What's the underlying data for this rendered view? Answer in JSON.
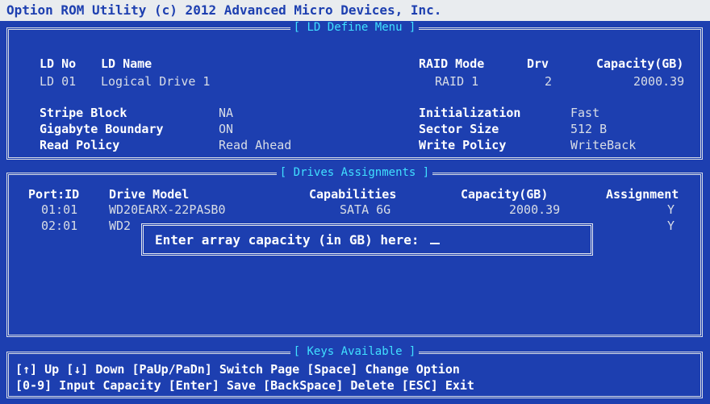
{
  "title": "Option ROM Utility (c) 2012 Advanced Micro Devices, Inc.",
  "ld_panel": {
    "title": "[ LD Define Menu ]",
    "headers": {
      "ld_no": "LD No",
      "ld_name": "LD Name",
      "raid_mode": "RAID Mode",
      "drv": "Drv",
      "capacity": "Capacity(GB)"
    },
    "row": {
      "ld_no": "LD 01",
      "ld_name": "Logical Drive 1",
      "raid_mode": "RAID 1",
      "drv": "2",
      "capacity": "2000.39"
    },
    "settings": {
      "stripe_block_label": "Stripe Block",
      "stripe_block_value": "NA",
      "gigabyte_boundary_label": "Gigabyte Boundary",
      "gigabyte_boundary_value": "ON",
      "read_policy_label": "Read Policy",
      "read_policy_value": "Read Ahead",
      "initialization_label": "Initialization",
      "initialization_value": "Fast",
      "sector_size_label": "Sector Size",
      "sector_size_value": "512  B",
      "write_policy_label": "Write Policy",
      "write_policy_value": "WriteBack"
    }
  },
  "drives_panel": {
    "title": "[ Drives Assignments ]",
    "headers": {
      "port_id": "Port:ID",
      "drive_model": "Drive Model",
      "capabilities": "Capabilities",
      "capacity": "Capacity(GB)",
      "assignment": "Assignment"
    },
    "rows": [
      {
        "port_id": "01:01",
        "drive_model": "WD20EARX-22PASB0",
        "capabilities": "SATA 6G",
        "capacity": "2000.39",
        "assignment": "Y"
      },
      {
        "port_id": "02:01",
        "drive_model": "WD2",
        "assignment": "Y"
      }
    ]
  },
  "dialog": {
    "prompt": "Enter array capacity (in GB) here: "
  },
  "keys_panel": {
    "title": "[ Keys Available ]",
    "line1": "[↑] Up  [↓] Down  [PaUp/PaDn] Switch Page  [Space] Change Option",
    "line2": "[0-9] Input Capacity   [Enter] Save   [BackSpace] Delete   [ESC] Exit"
  },
  "colors": {
    "background": "#1d3fb0",
    "title_bar": "#e9ecef",
    "panel_title": "#40e0ff",
    "text": "#ffffff"
  }
}
